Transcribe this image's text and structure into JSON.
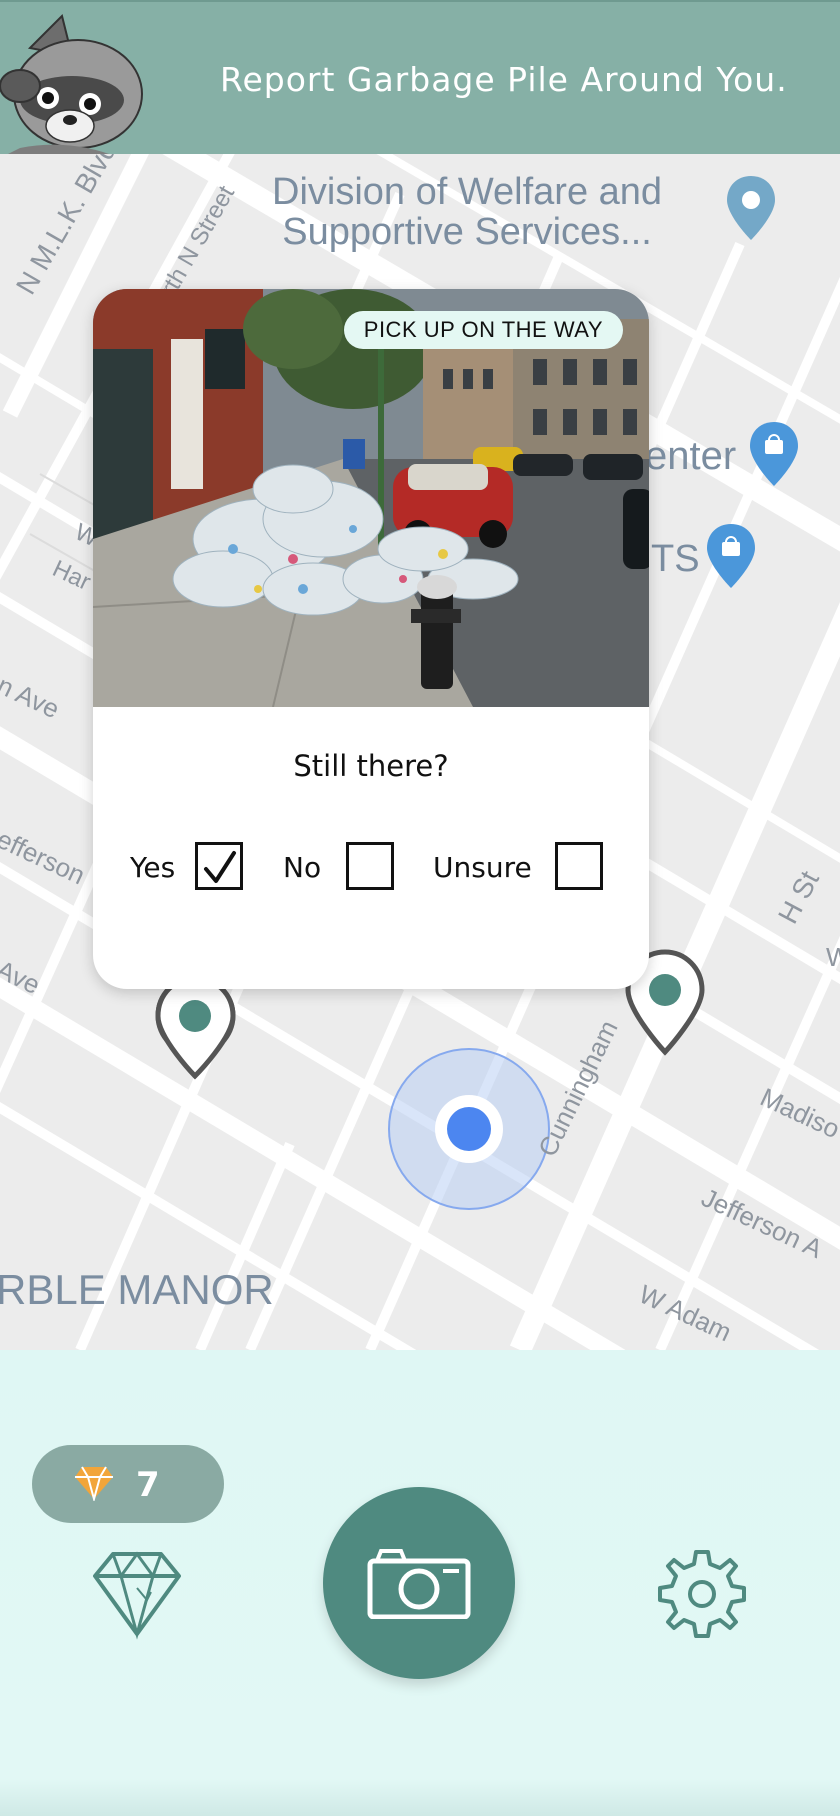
{
  "header": {
    "title": "Report Garbage Pile Around You."
  },
  "map": {
    "streets": [
      {
        "id": "mlk",
        "text": "N M.L.K. Blvd"
      },
      {
        "id": "north-n",
        "text": "North N Street"
      },
      {
        "id": "ha",
        "text": "Har"
      },
      {
        "id": "w",
        "text": "W"
      },
      {
        "id": "n-ave",
        "text": "n Ave"
      },
      {
        "id": "jefferson-left",
        "text": "efferson"
      },
      {
        "id": "ave-left",
        "text": "Ave"
      },
      {
        "id": "h-st",
        "text": "H St"
      },
      {
        "id": "w-edge",
        "text": "W"
      },
      {
        "id": "cunningham",
        "text": "Cunningham"
      },
      {
        "id": "madison",
        "text": "Madiso"
      },
      {
        "id": "jefferson-right",
        "text": "Jefferson A"
      },
      {
        "id": "w-adams",
        "text": "W Adam"
      }
    ],
    "neighborhood": "RBLE MANOR",
    "pois": [
      {
        "id": "welfare",
        "text_line1": "Division of Welfare and",
        "text_line2": "Supportive Services..."
      },
      {
        "id": "center",
        "text": "enter"
      },
      {
        "id": "ts",
        "text": "TS"
      }
    ],
    "colors": {
      "road": "#ffffff",
      "background": "#ececec",
      "poi_pin": "#74a8c8",
      "shop_pin": "#4b97da",
      "user_dot": "#4c86f0",
      "marker_fill": "#4f8a80",
      "marker_stroke": "#555555"
    }
  },
  "card": {
    "badge": "PICK UP ON THE WAY",
    "question": "Still there?",
    "options": [
      {
        "label": "Yes",
        "checked": true
      },
      {
        "label": "No",
        "checked": false
      },
      {
        "label": "Unsure",
        "checked": false
      }
    ]
  },
  "bottom": {
    "gem_count": "7",
    "icons": [
      "gem-icon",
      "camera-icon",
      "gear-icon"
    ],
    "colors": {
      "panel": "#dff7f4",
      "primary": "#4f8a80",
      "pill": "#8aaaa3",
      "gem": "#f2a53a"
    }
  }
}
